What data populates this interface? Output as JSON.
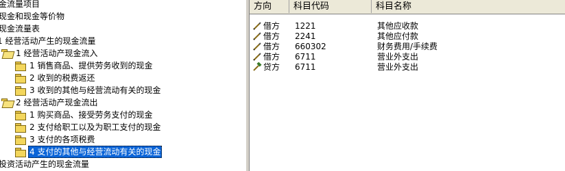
{
  "tree": {
    "nodes": [
      {
        "label": "金流量项目",
        "indent": 0,
        "folder": "none"
      },
      {
        "label": "现金和现金等价物",
        "indent": 0,
        "folder": "none"
      },
      {
        "label": "现金流量表",
        "indent": 0,
        "folder": "none"
      },
      {
        "label": "1  经营活动产生的现金流量",
        "indent": 0,
        "folder": "none"
      },
      {
        "label": "1  经营活动产现金流入",
        "indent": 0,
        "folder": "open"
      },
      {
        "label": "1  销售商品、提供劳务收到的现金",
        "indent": 1,
        "folder": "closed"
      },
      {
        "label": "2  收到的税费返还",
        "indent": 1,
        "folder": "closed"
      },
      {
        "label": "3  收到的其他与经营流动有关的现金",
        "indent": 1,
        "folder": "closed"
      },
      {
        "label": "2  经营活动产现金流出",
        "indent": 0,
        "folder": "open"
      },
      {
        "label": "1  购买商品、接受劳务支付的现金",
        "indent": 1,
        "folder": "closed"
      },
      {
        "label": "2  支付给职工以及为职工支付的现金",
        "indent": 1,
        "folder": "closed"
      },
      {
        "label": "3  支付的各项税费",
        "indent": 1,
        "folder": "closed"
      },
      {
        "label": "4  支付的其他与经营流动有关的现金",
        "indent": 1,
        "folder": "closed",
        "selected": true
      },
      {
        "label": "投资活动产生的现金流量",
        "indent": 0,
        "folder": "none"
      }
    ]
  },
  "grid": {
    "headers": {
      "direction": "方向",
      "code": "科目代码",
      "name": "科目名称"
    },
    "rows": [
      {
        "direction": "借方",
        "code": "1221",
        "name": "其他应收款",
        "icon": "pencil-icon"
      },
      {
        "direction": "借方",
        "code": "2241",
        "name": "其他应付款",
        "icon": "pencil-icon"
      },
      {
        "direction": "借方",
        "code": "660302",
        "name": "财务费用/手续费",
        "icon": "pencil-icon"
      },
      {
        "direction": "借方",
        "code": "6711",
        "name": "营业外支出",
        "icon": "pencil-icon"
      },
      {
        "direction": "贷方",
        "code": "6711",
        "name": "营业外支出",
        "icon": "hammer-icon"
      }
    ]
  }
}
